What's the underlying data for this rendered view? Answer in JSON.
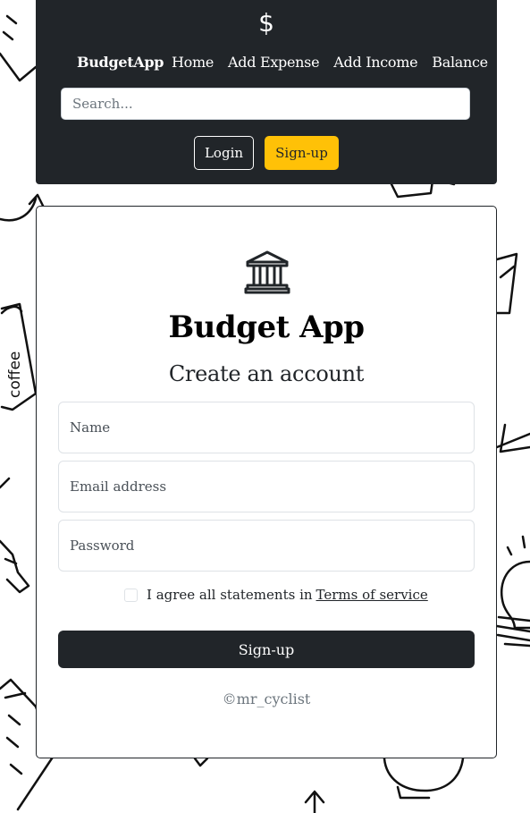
{
  "navbar": {
    "brand_icon": "dollar-sign-icon",
    "brand_symbol": "$",
    "brand": "BudgetApp",
    "links": [
      {
        "label": "Home"
      },
      {
        "label": "Add Expense"
      },
      {
        "label": "Add Income"
      },
      {
        "label": "Balance"
      }
    ],
    "search_placeholder": "Search...",
    "login_label": "Login",
    "signup_label": "Sign-up",
    "signup_color": "#ffc107",
    "background_color": "#212529"
  },
  "form": {
    "icon": "bank-icon",
    "app_title": "Budget App",
    "subtitle": "Create an account",
    "name_placeholder": "Name",
    "email_placeholder": "Email address",
    "password_placeholder": "Password",
    "terms_text": "I agree all statements in",
    "terms_link": "Terms of service",
    "terms_checked": false,
    "submit_label": "Sign-up",
    "footer": "©mr_cyclist"
  },
  "background": {
    "doodle_text": "coffee"
  }
}
